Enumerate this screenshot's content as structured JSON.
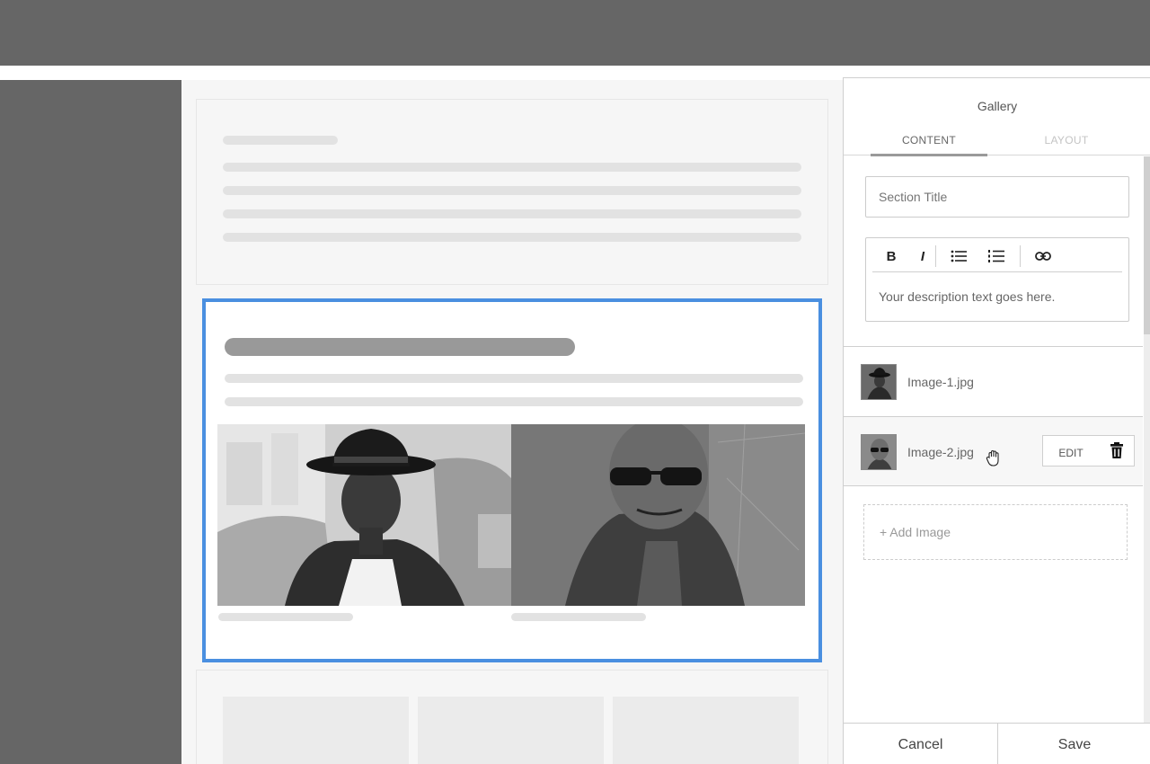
{
  "panel": {
    "title": "Gallery",
    "tabs": [
      {
        "label": "CONTENT",
        "active": true
      },
      {
        "label": "LAYOUT",
        "active": false
      }
    ],
    "section_title": {
      "value": "",
      "placeholder": "Section Title"
    },
    "description": {
      "text": "Your description text goes here."
    },
    "toolbar": [
      {
        "label": "B",
        "icon": "bold-icon"
      },
      {
        "label": "I",
        "icon": "italic-icon"
      },
      {
        "icon": "bullet-list-icon"
      },
      {
        "icon": "numbered-list-icon"
      },
      {
        "icon": "link-icon"
      }
    ],
    "images": [
      {
        "filename": "Image-1.jpg",
        "thumb_icon": "hat-man-photo"
      },
      {
        "filename": "Image-2.jpg",
        "thumb_icon": "sunglasses-man-photo",
        "hovered": true,
        "edit_label": "EDIT",
        "delete_icon": "trash-icon"
      }
    ],
    "add_image_label": "+ Add Image",
    "cancel_label": "Cancel",
    "save_label": "Save"
  },
  "colors": {
    "selection_border": "#4a8fe0",
    "chrome_gray": "#666666",
    "placeholder_bar": "#e2e2e2",
    "title_bar": "#999999"
  }
}
